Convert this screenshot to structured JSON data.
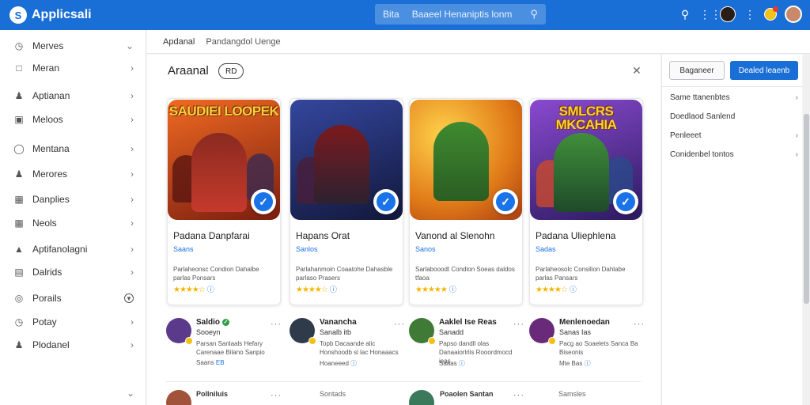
{
  "app": {
    "title": "Applicsali"
  },
  "search": {
    "prefix": "Bita",
    "value": "Baaeel Henaniptis lonm"
  },
  "topbar_icons": [
    "search-icon",
    "apps-grid-icon",
    "user-avatar",
    "more-vert-icon",
    "coin-notification-icon",
    "profile-avatar"
  ],
  "sidebar": {
    "items": [
      {
        "label": "Merves",
        "icon": "clock-icon",
        "chevron": "down"
      },
      {
        "label": "Meran",
        "icon": "edit-icon",
        "chevron": "right"
      },
      {
        "label": "Aptianan",
        "icon": "people-icon",
        "chevron": "right"
      },
      {
        "label": "Meloos",
        "icon": "monitor-icon",
        "chevron": "right"
      },
      {
        "label": "Mentana",
        "icon": "chat-icon",
        "chevron": "right"
      },
      {
        "label": "Merores",
        "icon": "people-icon",
        "chevron": "right"
      },
      {
        "label": "Danplies",
        "icon": "document-icon",
        "chevron": "right"
      },
      {
        "label": "Neols",
        "icon": "grid-icon",
        "chevron": "right"
      },
      {
        "label": "Aptifanolagni",
        "icon": "share-icon",
        "chevron": "right"
      },
      {
        "label": "Dalrids",
        "icon": "calendar-icon",
        "chevron": "right"
      },
      {
        "label": "Porails",
        "icon": "target-icon",
        "chevron": "circle"
      },
      {
        "label": "Potay",
        "icon": "history-icon",
        "chevron": "right"
      },
      {
        "label": "Plodanel",
        "icon": "person-icon",
        "chevron": "right"
      }
    ]
  },
  "breadcrumb": {
    "first": "Apdanal",
    "second": "Pandangdol Uenge"
  },
  "main": {
    "title": "Araanal",
    "count_badge": "RD",
    "cards": [
      {
        "art_title": "SAUDIEI LOOPEK",
        "name": "Padana Danpfarai",
        "category": "Saans",
        "desc": "Parlaheonsc Condion Dahalbe parlas Ponsars",
        "rating": "★★★★☆",
        "rating_info": "ⓘ",
        "colors": [
          "#e8561c",
          "#6b1a12",
          "#c23b2a"
        ]
      },
      {
        "art_title": "",
        "name": "Hapans Orat",
        "category": "Sanlos",
        "desc": "Parlahanmoin Coaatohe Dahasble parlaso Prasers",
        "rating": "★★★★☆",
        "rating_info": "ⓘ",
        "colors": [
          "#2b3a8f",
          "#161b3f",
          "#8d1c22"
        ]
      },
      {
        "art_title": "",
        "name": "Vanond al Slenohn",
        "category": "Sanos",
        "desc": "Sarlabooodt Condion Soeas daldos tfaoa",
        "rating": "★★★★★",
        "rating_info": "ⓘ",
        "colors": [
          "#f29a1b",
          "#b8471a",
          "#3a8a2e"
        ]
      },
      {
        "art_title": "SMLCRS MKCAHIA",
        "name": "Padana Uliephlena",
        "category": "Sadas",
        "desc": "Parlaheosolc Consilion Dahlabe parlas Pansars",
        "rating": "★★★★☆",
        "rating_info": "ⓘ",
        "colors": [
          "#7a3fc4",
          "#2a1a5e",
          "#3f8f3a"
        ]
      }
    ],
    "users": [
      {
        "name": "Saldio",
        "verified": true,
        "sub": "Sooeyn",
        "desc": "Parsan Sanlaals Hefary Carenaae Bilano Sanpio",
        "meta_label": "Saans",
        "meta_value": "EB",
        "color": "#5b3a8c"
      },
      {
        "name": "Vanancha",
        "verified": false,
        "sub": "Sanalb itb",
        "desc": "Topb Dacaande alic Honshoodb sl lac Honaaacs",
        "meta_label": "Hoaneeed",
        "meta_value": "ⓘ",
        "color": "#2f3b4a"
      },
      {
        "name": "Aaklel Ise Reas",
        "verified": false,
        "sub": "Sanadd",
        "desc": "Papso dandll olas Danaaiorlrlis Rooordmocd ieas",
        "meta_label": "Saaas",
        "meta_value": "ⓘ",
        "color": "#3f7a36"
      },
      {
        "name": "Menlenoedan",
        "verified": false,
        "sub": "Sanas Ias",
        "desc": "Pacg ao Soaelets Sanca Ba Biseonis",
        "meta_label": "Mte Bas",
        "meta_value": "ⓘ",
        "color": "#6a2a7a"
      }
    ],
    "lower_row": [
      {
        "label": "Pollniluis",
        "type": "user",
        "color": "#a0523a"
      },
      {
        "label": "Sontads",
        "type": "text"
      },
      {
        "label": "Poaolen Santan",
        "type": "user",
        "color": "#3a7a5a"
      },
      {
        "label": "Samsles",
        "type": "text"
      }
    ]
  },
  "right_panel": {
    "secondary_button": "Baganeer",
    "primary_button": "Dealed leaenb",
    "items": [
      {
        "label": "Same ttanenbtes",
        "chevron": true
      },
      {
        "label": "Doedlaod Sanlend",
        "chevron": false
      },
      {
        "label": "Penleeet",
        "chevron": true
      },
      {
        "label": "Conidenbel tontos",
        "chevron": true
      }
    ]
  }
}
